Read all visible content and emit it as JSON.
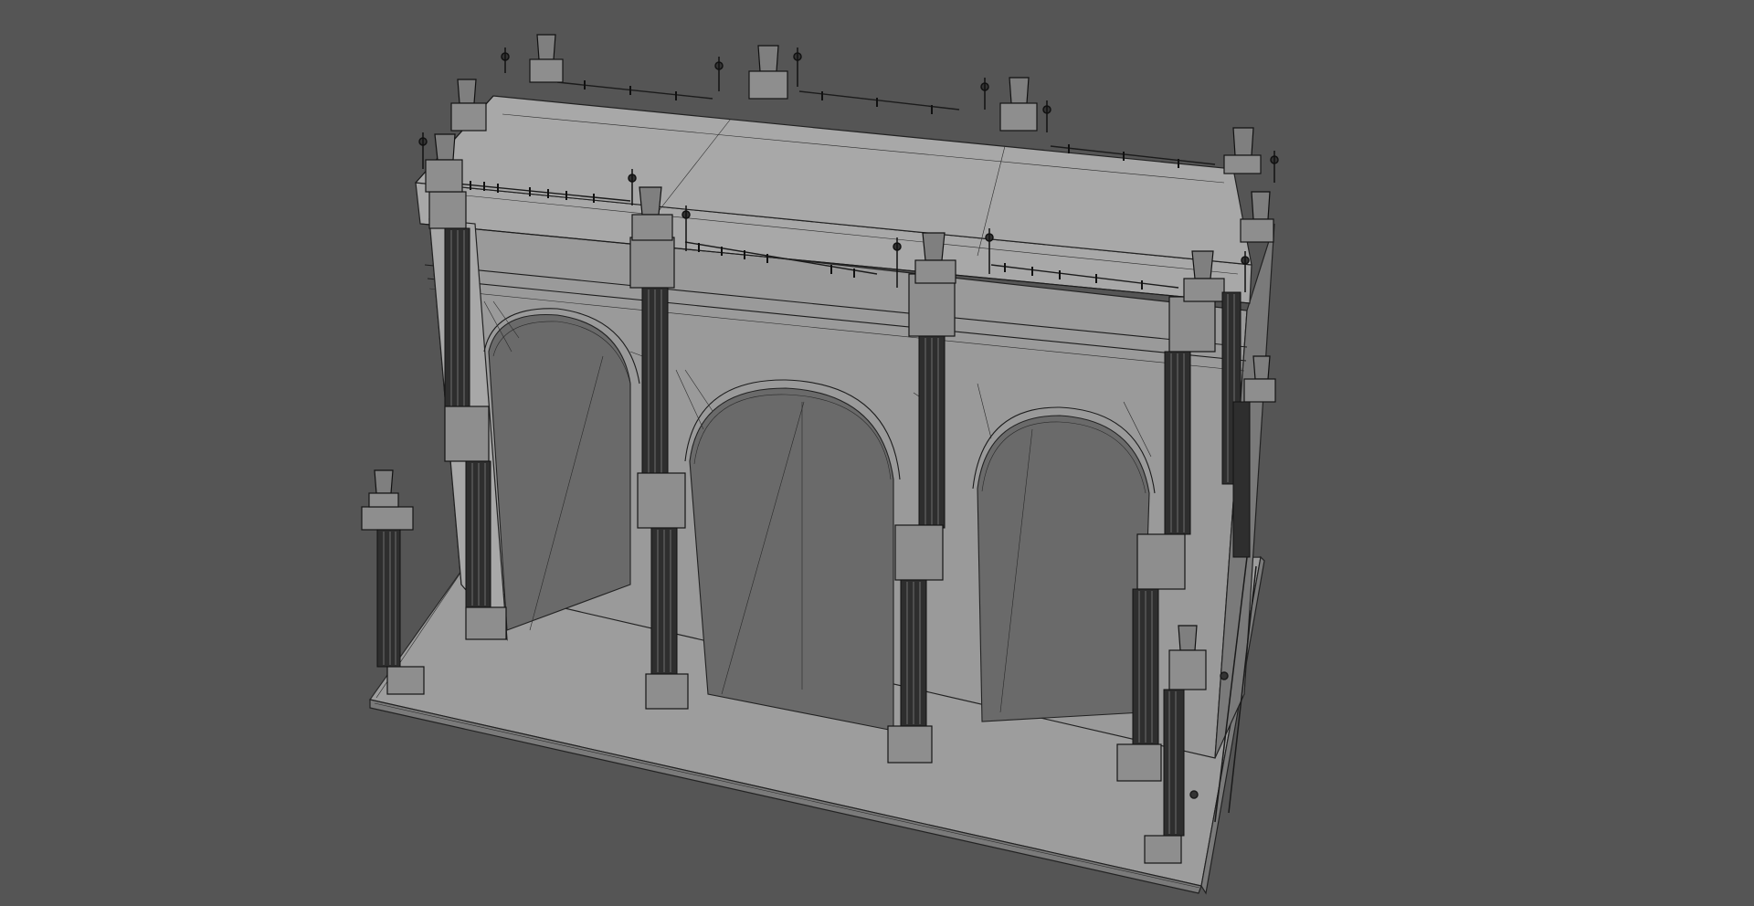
{
  "viewport": {
    "background": "#555555",
    "subject": "wireframe-3d-model"
  },
  "model": {
    "style": "clay-wireframe",
    "base_color": "#9d9d9d",
    "edge_color": "#1c1c1c"
  }
}
